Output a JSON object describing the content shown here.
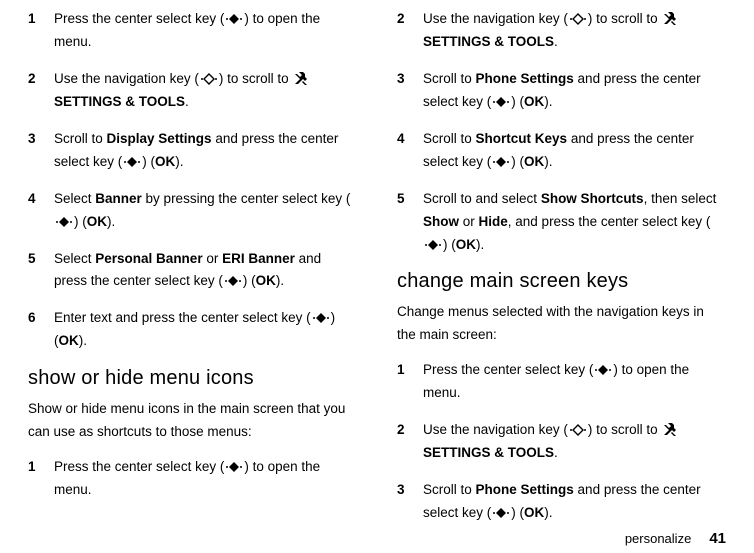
{
  "left": {
    "stepsA": [
      {
        "num": "1",
        "parts": [
          "Press the center select key (",
          "{center}",
          ") to open the menu."
        ]
      },
      {
        "num": "2",
        "parts": [
          "Use the navigation key (",
          "{nav}",
          ") to scroll to ",
          "{settings}",
          " ",
          "{b:SETTINGS & TOOLS}",
          "."
        ]
      },
      {
        "num": "3",
        "parts": [
          "Scroll to ",
          "{b:Display Settings}",
          " and press the center select key (",
          "{center}",
          ") (",
          "{b:OK}",
          ")."
        ]
      },
      {
        "num": "4",
        "parts": [
          "Select ",
          "{b:Banner}",
          " by pressing the center select key (",
          "{center}",
          ") (",
          "{b:OK}",
          ")."
        ]
      },
      {
        "num": "5",
        "parts": [
          "Select ",
          "{b:Personal Banner}",
          " or ",
          "{b:ERI Banner}",
          " and press the center select key (",
          "{center}",
          ") (",
          "{b:OK}",
          ")."
        ]
      },
      {
        "num": "6",
        "parts": [
          "Enter text and press the center select key (",
          "{center}",
          ") (",
          "{b:OK}",
          ")."
        ]
      }
    ],
    "headingA": "show or hide menu icons",
    "introA": "Show or hide menu icons in the main screen that you can use as shortcuts to those menus:",
    "stepsB": [
      {
        "num": "1",
        "parts": [
          "Press the center select key (",
          "{center}",
          ") to open the menu."
        ]
      }
    ]
  },
  "right": {
    "stepsA": [
      {
        "num": "2",
        "parts": [
          "Use the navigation key (",
          "{nav}",
          ") to scroll to ",
          "{settings}",
          " ",
          "{b:SETTINGS & TOOLS}",
          "."
        ]
      },
      {
        "num": "3",
        "parts": [
          "Scroll to ",
          "{b:Phone Settings}",
          " and press the center select key (",
          "{center}",
          ") (",
          "{b:OK}",
          ")."
        ]
      },
      {
        "num": "4",
        "parts": [
          "Scroll to ",
          "{b:Shortcut Keys}",
          " and press the center select key (",
          "{center}",
          ") (",
          "{b:OK}",
          ")."
        ]
      },
      {
        "num": "5",
        "parts": [
          "Scroll to and select ",
          "{b:Show Shortcuts}",
          ", then select ",
          "{b:Show}",
          " or ",
          "{b:Hide}",
          ", and press the center select key (",
          "{center}",
          ") (",
          "{b:OK}",
          ")."
        ]
      }
    ],
    "headingA": "change main screen keys",
    "introA": "Change menus selected with the navigation keys in the main screen:",
    "stepsB": [
      {
        "num": "1",
        "parts": [
          "Press the center select key (",
          "{center}",
          ") to open the menu."
        ]
      },
      {
        "num": "2",
        "parts": [
          "Use the navigation key (",
          "{nav}",
          ") to scroll to ",
          "{settings}",
          " ",
          "{b:SETTINGS & TOOLS}",
          "."
        ]
      },
      {
        "num": "3",
        "parts": [
          "Scroll to ",
          "{b:Phone Settings}",
          " and press the center select key (",
          "{center}",
          ") (",
          "{b:OK}",
          ")."
        ]
      }
    ]
  },
  "footer": {
    "label": "personalize",
    "page": "41"
  }
}
